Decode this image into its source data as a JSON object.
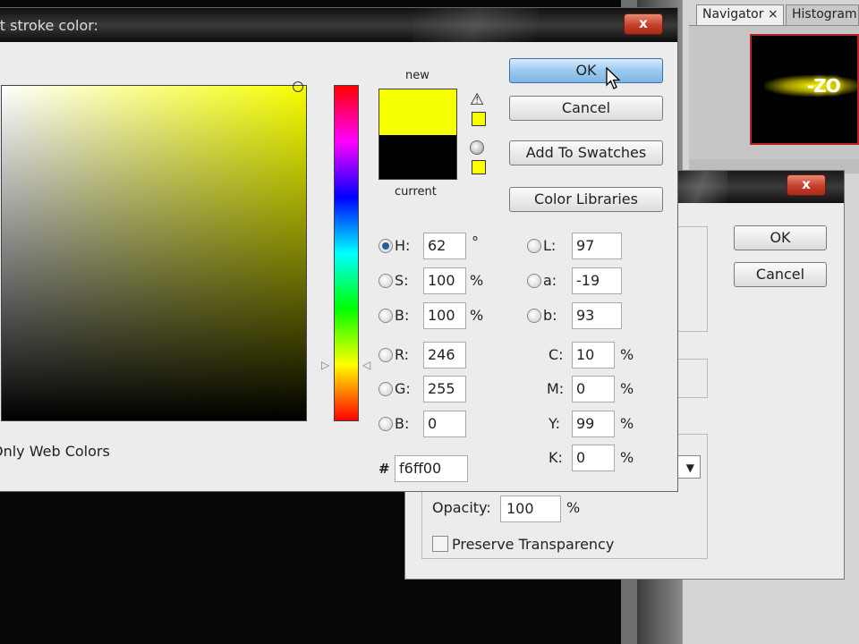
{
  "picker": {
    "title": "ct stroke color:",
    "new_label": "new",
    "current_label": "current",
    "new_color": "#f6ff00",
    "current_color": "#000000",
    "buttons": {
      "ok": "OK",
      "cancel": "Cancel",
      "add_to_swatches": "Add To Swatches",
      "color_libraries": "Color Libraries"
    },
    "fields": {
      "H": {
        "label": "H:",
        "value": "62",
        "unit": "°",
        "selected": true
      },
      "S": {
        "label": "S:",
        "value": "100",
        "unit": "%"
      },
      "B": {
        "label": "B:",
        "value": "100",
        "unit": "%"
      },
      "R": {
        "label": "R:",
        "value": "246"
      },
      "G": {
        "label": "G:",
        "value": "255"
      },
      "Bl": {
        "label": "B:",
        "value": "0"
      },
      "L": {
        "label": "L:",
        "value": "97"
      },
      "a": {
        "label": "a:",
        "value": "-19"
      },
      "b": {
        "label": "b:",
        "value": "93"
      },
      "C": {
        "label": "C:",
        "value": "10",
        "unit": "%"
      },
      "M": {
        "label": "M:",
        "value": "0",
        "unit": "%"
      },
      "Y": {
        "label": "Y:",
        "value": "99",
        "unit": "%"
      },
      "K": {
        "label": "K:",
        "value": "0",
        "unit": "%"
      }
    },
    "hex_label": "#",
    "hex_value": "f6ff00",
    "only_web_colors": "Only Web Colors",
    "close_symbol": "x"
  },
  "stroke_dialog": {
    "ok": "OK",
    "cancel": "Cancel",
    "opacity_label": "Opacity:",
    "opacity_value": "100",
    "opacity_unit": "%",
    "preserve_label": "Preserve Transparency",
    "close_symbol": "x"
  },
  "panels": {
    "tabs": [
      {
        "label": "Navigator ×"
      },
      {
        "label": "Histogram"
      }
    ],
    "preview_text": "-ZO"
  },
  "icons": {
    "gamut_warning": "warning-triangle-icon",
    "web_safe": "web-cube-icon",
    "cursor": "arrow-cursor-icon"
  }
}
